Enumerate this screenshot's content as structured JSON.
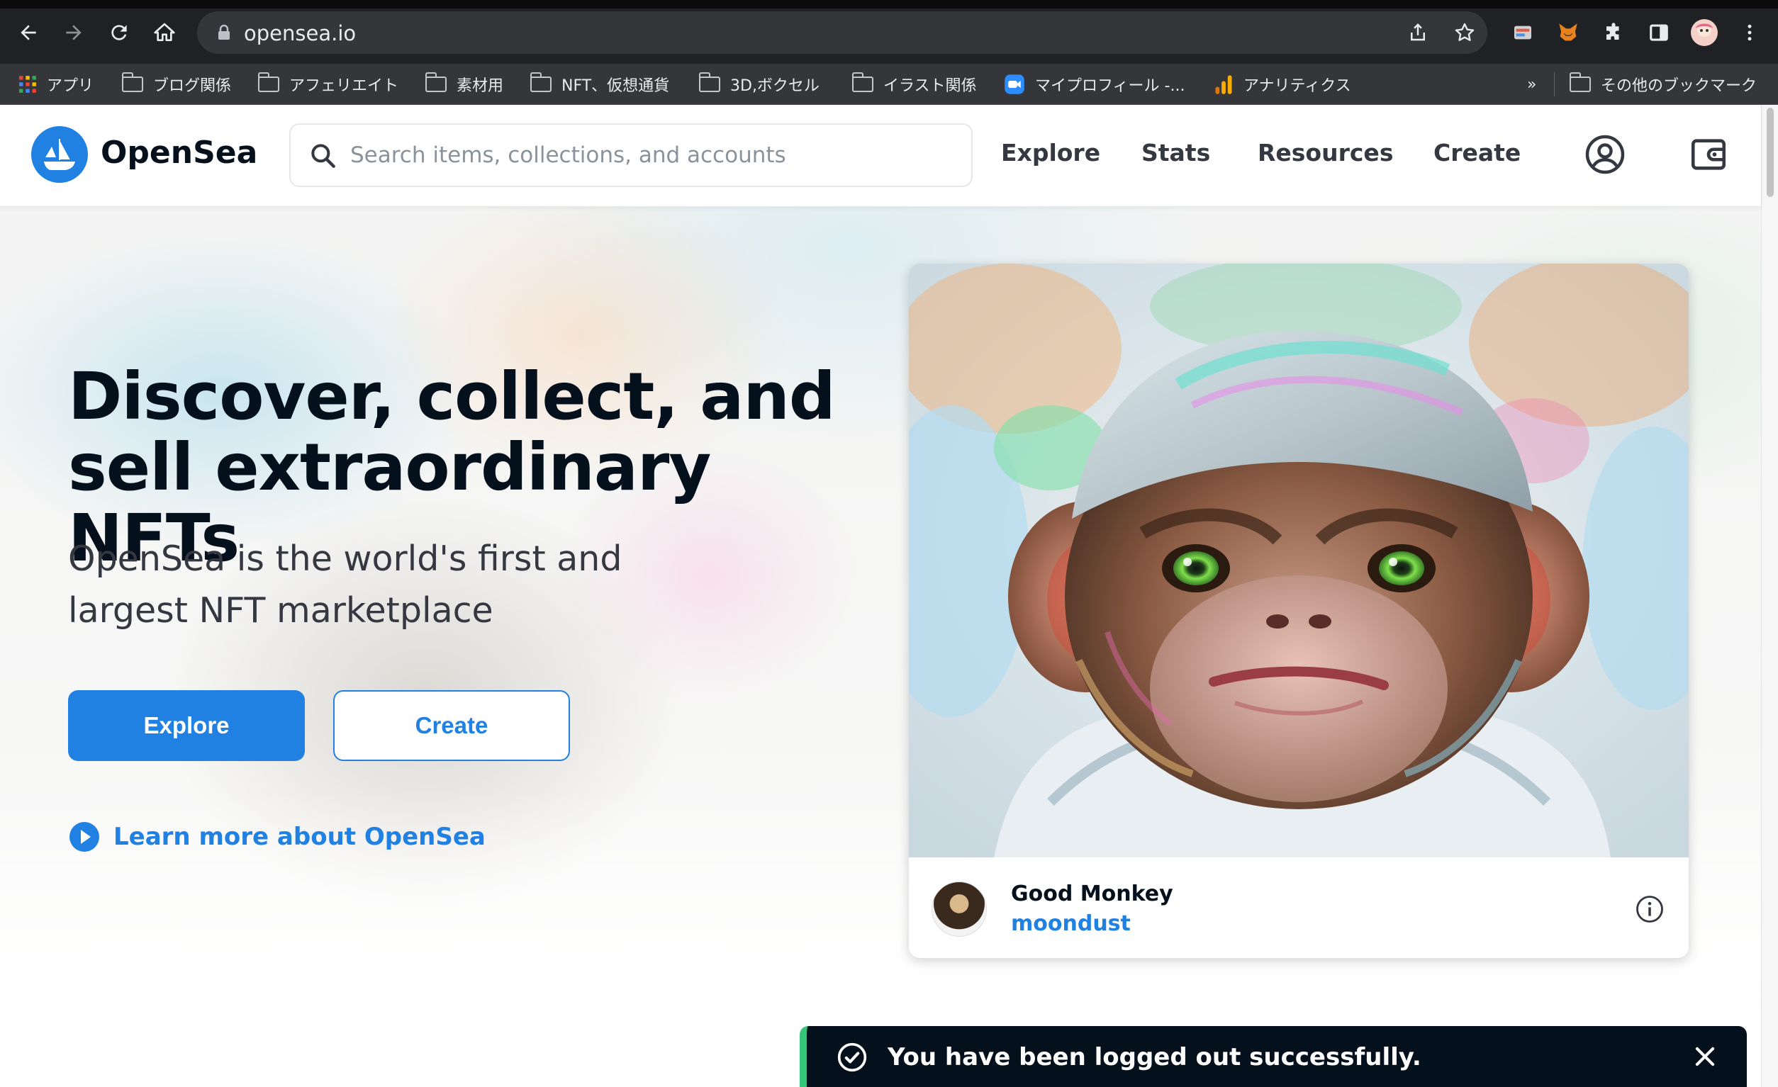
{
  "browser": {
    "url": "opensea.io",
    "bookmarks": [
      {
        "label": "アプリ",
        "type": "apps"
      },
      {
        "label": "ブログ関係",
        "type": "folder"
      },
      {
        "label": "アフェリエイト",
        "type": "folder"
      },
      {
        "label": "素材用",
        "type": "folder"
      },
      {
        "label": "NFT、仮想通貨",
        "type": "folder"
      },
      {
        "label": "3D,ボクセル",
        "type": "folder"
      },
      {
        "label": "イラスト関係",
        "type": "folder"
      },
      {
        "label": "マイプロフィール -...",
        "type": "zoom"
      },
      {
        "label": "アナリティクス",
        "type": "analytics"
      }
    ],
    "overflow_label": "»",
    "other_bookmarks": "その他のブックマーク"
  },
  "header": {
    "brand": "OpenSea",
    "search_placeholder": "Search items, collections, and accounts",
    "nav": [
      "Explore",
      "Stats",
      "Resources",
      "Create"
    ]
  },
  "hero": {
    "headline": "Discover, collect, and sell extraordinary NFTs",
    "subhead": "OpenSea is the world's first and largest NFT marketplace",
    "explore_label": "Explore",
    "create_label": "Create",
    "learn_more": "Learn more about OpenSea"
  },
  "featured": {
    "title": "Good Monkey",
    "creator": "moondust"
  },
  "toast": {
    "message": "You have been logged out successfully."
  },
  "colors": {
    "accent": "#2081e2",
    "text_dark": "#04111d",
    "toast_bg": "#04111d",
    "toast_success": "#34c77b"
  }
}
